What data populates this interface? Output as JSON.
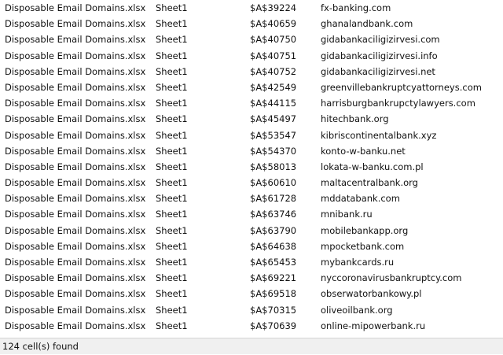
{
  "results": {
    "rows": [
      {
        "book": "Disposable Email Domains.xlsx",
        "sheet": "Sheet1",
        "cell": "$A$39224",
        "value": "fx-banking.com"
      },
      {
        "book": "Disposable Email Domains.xlsx",
        "sheet": "Sheet1",
        "cell": "$A$40659",
        "value": "ghanalandbank.com"
      },
      {
        "book": "Disposable Email Domains.xlsx",
        "sheet": "Sheet1",
        "cell": "$A$40750",
        "value": "gidabankaciligizirvesi.com"
      },
      {
        "book": "Disposable Email Domains.xlsx",
        "sheet": "Sheet1",
        "cell": "$A$40751",
        "value": "gidabankaciligizirvesi.info"
      },
      {
        "book": "Disposable Email Domains.xlsx",
        "sheet": "Sheet1",
        "cell": "$A$40752",
        "value": "gidabankaciligizirvesi.net"
      },
      {
        "book": "Disposable Email Domains.xlsx",
        "sheet": "Sheet1",
        "cell": "$A$42549",
        "value": "greenvillebankruptcyattorneys.com"
      },
      {
        "book": "Disposable Email Domains.xlsx",
        "sheet": "Sheet1",
        "cell": "$A$44115",
        "value": "harrisburgbankrupctylawyers.com"
      },
      {
        "book": "Disposable Email Domains.xlsx",
        "sheet": "Sheet1",
        "cell": "$A$45497",
        "value": "hitechbank.org"
      },
      {
        "book": "Disposable Email Domains.xlsx",
        "sheet": "Sheet1",
        "cell": "$A$53547",
        "value": "kibriscontinentalbank.xyz"
      },
      {
        "book": "Disposable Email Domains.xlsx",
        "sheet": "Sheet1",
        "cell": "$A$54370",
        "value": "konto-w-banku.net"
      },
      {
        "book": "Disposable Email Domains.xlsx",
        "sheet": "Sheet1",
        "cell": "$A$58013",
        "value": "lokata-w-banku.com.pl"
      },
      {
        "book": "Disposable Email Domains.xlsx",
        "sheet": "Sheet1",
        "cell": "$A$60610",
        "value": "maltacentralbank.org"
      },
      {
        "book": "Disposable Email Domains.xlsx",
        "sheet": "Sheet1",
        "cell": "$A$61728",
        "value": "mddatabank.com"
      },
      {
        "book": "Disposable Email Domains.xlsx",
        "sheet": "Sheet1",
        "cell": "$A$63746",
        "value": "mnibank.ru"
      },
      {
        "book": "Disposable Email Domains.xlsx",
        "sheet": "Sheet1",
        "cell": "$A$63790",
        "value": "mobilebankapp.org"
      },
      {
        "book": "Disposable Email Domains.xlsx",
        "sheet": "Sheet1",
        "cell": "$A$64638",
        "value": "mpocketbank.com"
      },
      {
        "book": "Disposable Email Domains.xlsx",
        "sheet": "Sheet1",
        "cell": "$A$65453",
        "value": "mybankcards.ru"
      },
      {
        "book": "Disposable Email Domains.xlsx",
        "sheet": "Sheet1",
        "cell": "$A$69221",
        "value": "nyccoronavirusbankruptcy.com"
      },
      {
        "book": "Disposable Email Domains.xlsx",
        "sheet": "Sheet1",
        "cell": "$A$69518",
        "value": "obserwatorbankowy.pl"
      },
      {
        "book": "Disposable Email Domains.xlsx",
        "sheet": "Sheet1",
        "cell": "$A$70315",
        "value": "oliveoilbank.org"
      },
      {
        "book": "Disposable Email Domains.xlsx",
        "sheet": "Sheet1",
        "cell": "$A$70639",
        "value": "online-mipowerbank.ru"
      }
    ]
  },
  "status": {
    "text": "124 cell(s) found"
  }
}
